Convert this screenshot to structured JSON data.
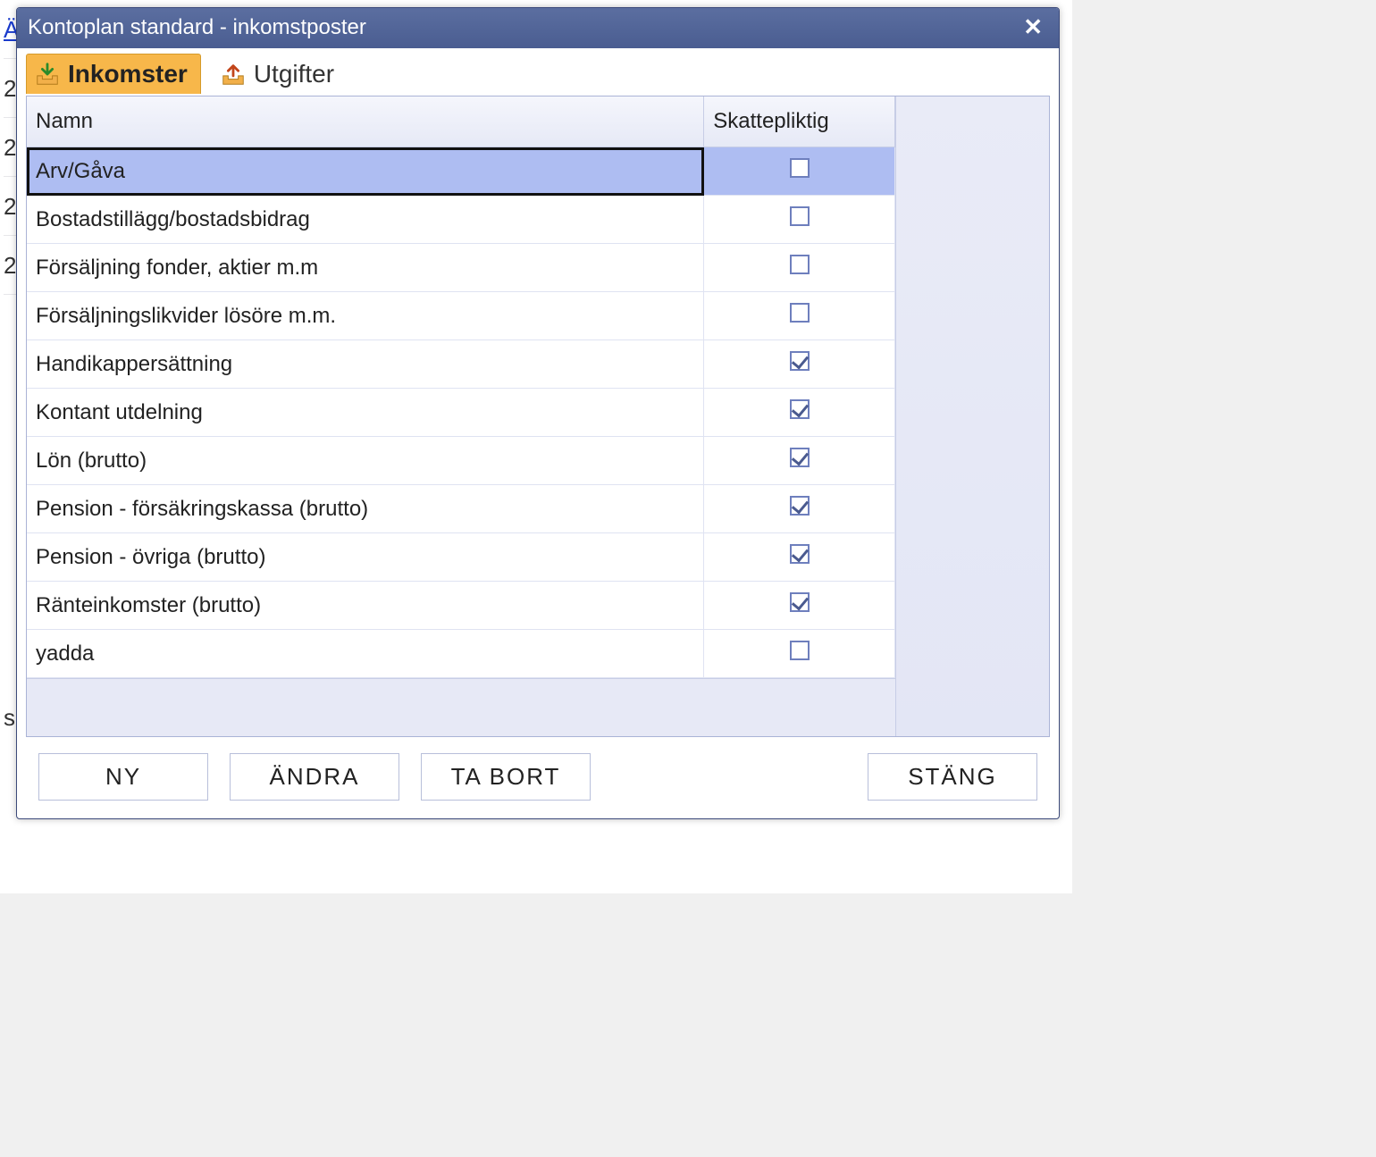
{
  "window": {
    "title": "Kontoplan standard - inkomstposter"
  },
  "tabs": {
    "income": "Inkomster",
    "expenses": "Utgifter"
  },
  "columns": {
    "name": "Namn",
    "taxable": "Skattepliktig"
  },
  "rows": [
    {
      "name": "Arv/Gåva",
      "taxable": false,
      "selected": true
    },
    {
      "name": "Bostadstillägg/bostadsbidrag",
      "taxable": false,
      "selected": false
    },
    {
      "name": "Försäljning fonder, aktier m.m",
      "taxable": false,
      "selected": false
    },
    {
      "name": "Försäljningslikvider lösöre m.m.",
      "taxable": false,
      "selected": false
    },
    {
      "name": "Handikappersättning",
      "taxable": true,
      "selected": false
    },
    {
      "name": "Kontant utdelning",
      "taxable": true,
      "selected": false
    },
    {
      "name": "Lön (brutto)",
      "taxable": true,
      "selected": false
    },
    {
      "name": "Pension - försäkringskassa (brutto)",
      "taxable": true,
      "selected": false
    },
    {
      "name": "Pension - övriga (brutto)",
      "taxable": true,
      "selected": false
    },
    {
      "name": "Ränteinkomster (brutto)",
      "taxable": true,
      "selected": false
    },
    {
      "name": "yadda",
      "taxable": false,
      "selected": false
    }
  ],
  "buttons": {
    "new": "NY",
    "edit": "ÄNDRA",
    "delete": "TA BORT",
    "close": "STÄNG"
  },
  "background": {
    "line1": "ÄL",
    "line2": "2",
    "line3": "2",
    "line4": "2",
    "line5": "2",
    "line6": "s"
  }
}
